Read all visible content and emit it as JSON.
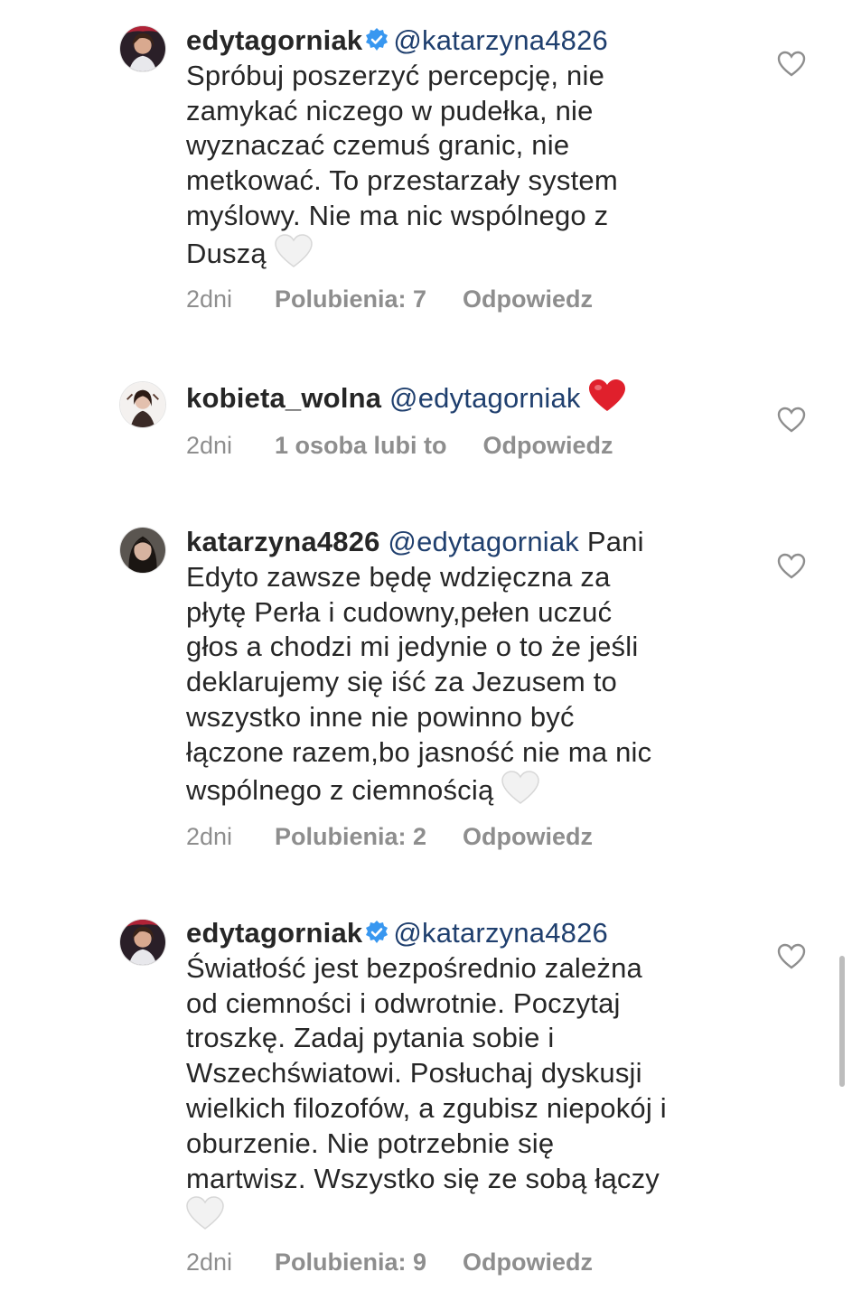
{
  "comments": [
    {
      "username": "edytagorniak",
      "verified": true,
      "mention": "@katarzyna4826",
      "text": "Spróbuj poszerzyć percepcję, nie\nzamykać niczego w pudełka, nie\nwyznaczać czemuś granic, nie\nmetkować. To przestarzały system\nmyślowy. Nie ma nic wspólnego z\nDuszą",
      "emoji": "white-heart",
      "time": "2dni",
      "likes": "Polubienia: 7",
      "reply": "Odpowiedz"
    },
    {
      "username": "kobieta_wolna",
      "verified": false,
      "mention": "@edytagorniak",
      "text": "",
      "emoji": "red-heart",
      "time": "2dni",
      "likes": "1 osoba lubi to",
      "reply": "Odpowiedz"
    },
    {
      "username": "katarzyna4826",
      "verified": false,
      "mention": "@edytagorniak",
      "text": "Pani\nEdyto zawsze będę wdzięczna za\npłytę Perła i cudowny,pełen uczuć\ngłos a chodzi  mi jedynie o to że jeśli\ndeklarujemy się  iść  za Jezusem to\nwszystko inne nie powinno być\nłączone razem,bo jasność  nie ma nic\nwspólnego z ciemnością",
      "emoji": "white-heart",
      "time": "2dni",
      "likes": "Polubienia: 2",
      "reply": "Odpowiedz"
    },
    {
      "username": "edytagorniak",
      "verified": true,
      "mention": "@katarzyna4826",
      "text": "Światłość jest bezpośrednio zależna\nod ciemności i odwrotnie. Poczytaj\ntroszkę. Zadaj pytania sobie i\nWszechświatowi. Posłuchaj dyskusji\nwielkich filozofów, a zgubisz niepokój i\noburzenie. Nie potrzebnie się\nmartwisz. Wszystko się ze sobą łączy\n",
      "emoji": "white-heart",
      "time": "2dni",
      "likes": "Polubienia: 9",
      "reply": "Odpowiedz"
    }
  ],
  "colors": {
    "mention": "#1f3f6e",
    "meta": "#8e8e8e",
    "verified": "#3897f0",
    "red_heart": "#e0202c"
  }
}
